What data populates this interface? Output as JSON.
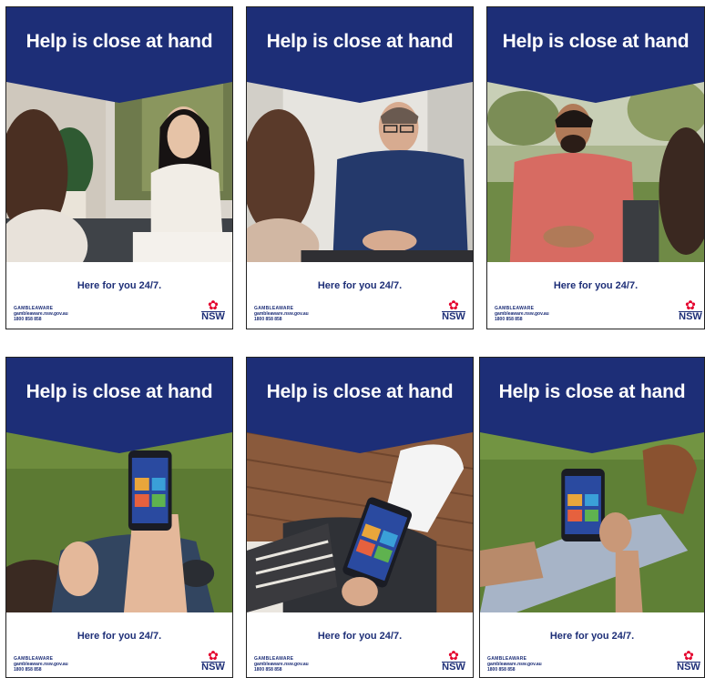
{
  "posters": [
    {
      "headline": "Help is close at hand",
      "tagline": "Here for you 24/7.",
      "scene": "woman-talking-indoors"
    },
    {
      "headline": "Help is close at hand",
      "tagline": "Here for you 24/7.",
      "scene": "man-in-blue-sweater-talking"
    },
    {
      "headline": "Help is close at hand",
      "tagline": "Here for you 24/7.",
      "scene": "man-in-pink-shirt-outdoors"
    },
    {
      "headline": "Help is close at hand",
      "tagline": "Here for you 24/7.",
      "scene": "phone-on-grass"
    },
    {
      "headline": "Help is close at hand",
      "tagline": "Here for you 24/7.",
      "scene": "phone-on-deck"
    },
    {
      "headline": "Help is close at hand",
      "tagline": "Here for you 24/7.",
      "scene": "phone-with-boots-on-grass"
    }
  ],
  "footer": {
    "brand": "GAMBLEAWARE",
    "site": "gambleaware.nsw.gov.au",
    "phone": "1800 858 858"
  },
  "logo": {
    "word": "NSW",
    "glyph": "✿"
  },
  "colors": {
    "banner": "#1d2e77",
    "tagline": "#1d2e77",
    "logo_red": "#e4002b"
  }
}
